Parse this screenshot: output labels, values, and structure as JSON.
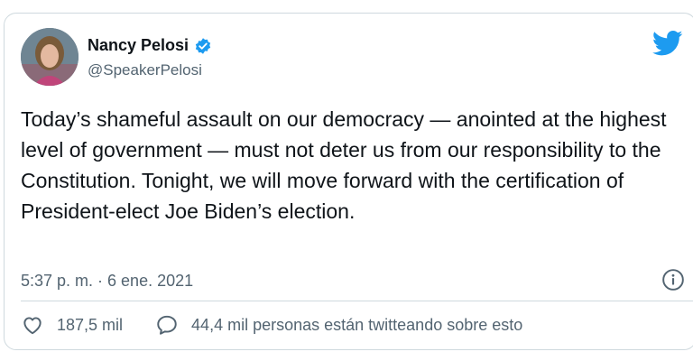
{
  "tweet": {
    "author": {
      "name": "Nancy Pelosi",
      "handle": "@SpeakerPelosi",
      "verified": true
    },
    "text": "Today’s shameful assault on our democracy — anointed at the highest level of government — must not deter us from our responsibility to the Constitution. Tonight, we will move forward with the certification of President-elect Joe Biden’s election.",
    "timestamp": "5:37 p. m. · 6 ene. 2021",
    "likes": "187,5 mil",
    "conversation": "44,4 mil personas están twitteando sobre esto"
  },
  "icons": {
    "brand": "twitter-bird-icon",
    "verified": "verified-badge-icon",
    "info": "info-icon",
    "like": "heart-icon",
    "reply": "speech-bubble-icon"
  },
  "colors": {
    "brand_blue": "#1d9bf0",
    "text_primary": "#0f1419",
    "text_secondary": "#536471",
    "border": "#cfd9de"
  }
}
